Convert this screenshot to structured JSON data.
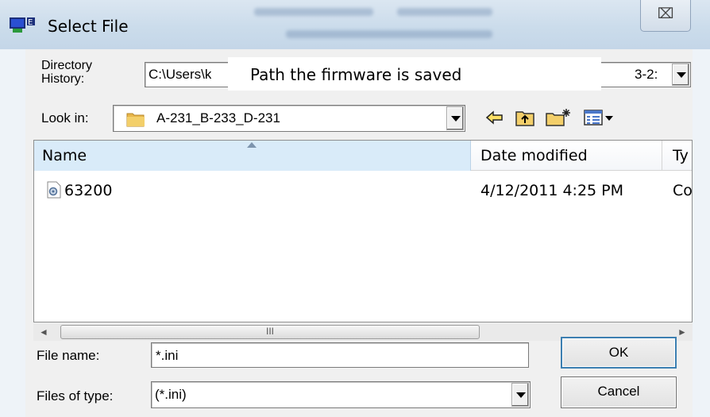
{
  "window": {
    "title": "Select File",
    "close_label": "⌧"
  },
  "annotation": {
    "text": "Path the firmware is saved"
  },
  "directory_history": {
    "label_line1": "Directory",
    "label_line2": "History:",
    "value_left": "C:\\Users\\k",
    "value_right": "3-2:"
  },
  "look_in": {
    "label": "Look in:",
    "value": "A-231_B-233_D-231"
  },
  "toolbar": {
    "back_icon": "back-arrow-icon",
    "up_icon": "up-folder-icon",
    "new_folder_icon": "new-folder-icon",
    "view_menu_icon": "view-menu-icon"
  },
  "file_list": {
    "columns": [
      "Name",
      "Date modified",
      "Ty"
    ],
    "rows": [
      {
        "name": "63200",
        "date_modified": "4/12/2011 4:25 PM",
        "type": "Co"
      }
    ]
  },
  "scrollbar": {
    "left": "◄",
    "grip": "III",
    "right": "►"
  },
  "file_name": {
    "label": "File name:",
    "value": "*.ini"
  },
  "files_of_type": {
    "label": "Files of type:",
    "value": "(*.ini)"
  },
  "buttons": {
    "ok": "OK",
    "cancel": "Cancel"
  },
  "colors": {
    "title_bar": "#cbdceb",
    "header_highlight": "#d9ebf9",
    "folder": "#e8b64a"
  }
}
